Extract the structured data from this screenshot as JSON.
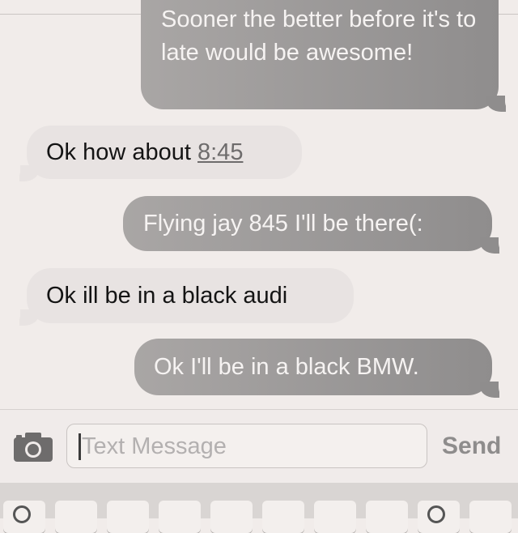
{
  "messages": [
    {
      "direction": "outgoing",
      "text": "Sooner the better before it's to late would be awesome!"
    },
    {
      "direction": "incoming",
      "text_before_link": "Ok how about ",
      "link_text": "8:45"
    },
    {
      "direction": "outgoing",
      "text": "Flying jay 845 I'll be there(:"
    },
    {
      "direction": "incoming",
      "text": "Ok ill be in a black audi"
    },
    {
      "direction": "outgoing",
      "text": "Ok I'll be in a black BMW."
    }
  ],
  "composer": {
    "camera_icon": "camera-icon",
    "placeholder": "Text Message",
    "send_label": "Send"
  },
  "colors": {
    "background": "#f1ecea",
    "outgoing_bubble": "#8f8d8d",
    "incoming_bubble": "#e8e3e2"
  }
}
